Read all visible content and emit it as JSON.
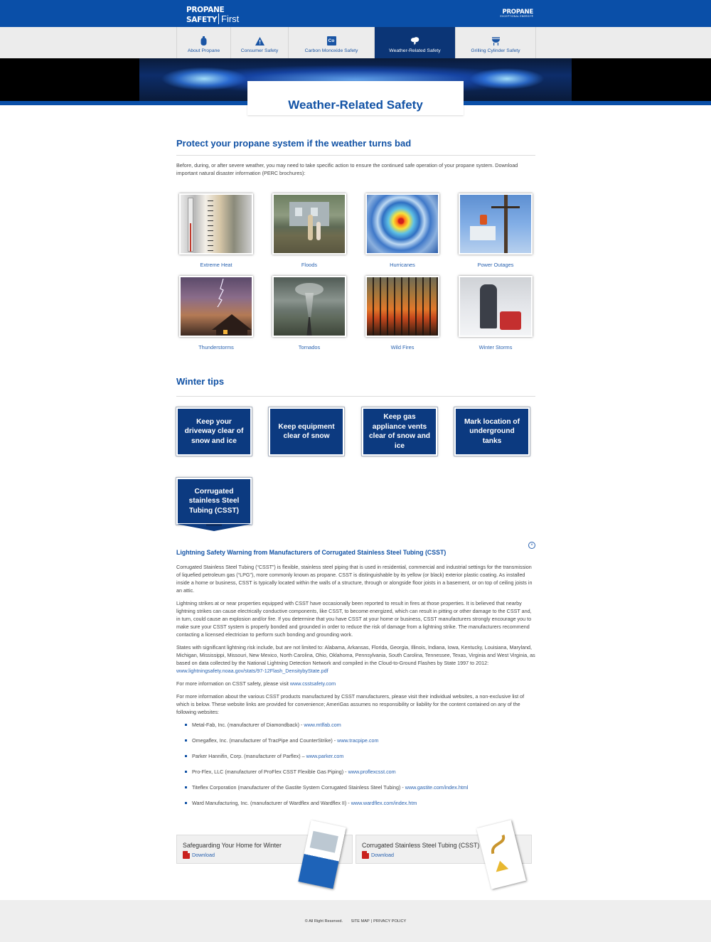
{
  "header": {
    "logo_line1": "PROPANE",
    "logo_line2": "SAFETY",
    "logo_line3": "First",
    "brand_right_line1": "PROPANE",
    "brand_right_line2": "EXCEPTIONAL ENERGY®",
    "colors": {
      "primary": "#0a4fa8",
      "nav_active": "#0b3576",
      "tile": "#0c3a80"
    }
  },
  "nav": [
    {
      "label": "About Propane",
      "icon": "propane-tank-icon"
    },
    {
      "label": "Consumer Safety",
      "icon": "warning-triangle-icon"
    },
    {
      "label": "Carbon Monoxide Safety",
      "icon": "co-badge-icon",
      "badge": "Co"
    },
    {
      "label": "Weather-Related Safety",
      "icon": "storm-cloud-icon",
      "active": true
    },
    {
      "label": "Grilling Cylinder Safety",
      "icon": "grill-icon"
    }
  ],
  "page_title": "Weather-Related Safety",
  "section1": {
    "heading": "Protect your propane system if the weather turns bad",
    "intro": "Before, during, or after severe weather, you may need to take specific action to ensure the continued safe operation of your propane system. Download important natural disaster information (PERC brochures):",
    "cards": [
      {
        "label": "Extreme Heat"
      },
      {
        "label": "Floods"
      },
      {
        "label": "Hurricanes"
      },
      {
        "label": "Power Outages"
      },
      {
        "label": "Thunderstorms"
      },
      {
        "label": "Tornados"
      },
      {
        "label": "Wild Fires"
      },
      {
        "label": "Winter Storms"
      }
    ]
  },
  "section2": {
    "heading": "Winter tips",
    "tips": [
      "Keep your driveway clear of snow and ice",
      "Keep equipment clear of snow",
      "Keep gas appliance vents clear of snow and ice",
      "Mark location of underground tanks",
      "Corrugated stainless Steel Tubing (CSST)"
    ]
  },
  "csst": {
    "close": "×",
    "heading": "Lightning Safety Warning from Manufacturers of Corrugated Stainless Steel Tubing (CSST)",
    "p1": "Corrugated Stainless Steel Tubing (“CSST”) is flexible, stainless steel piping that is used in residential, commercial and industrial settings for the transmission of liquefied petroleum gas (“LPG”), more commonly known as propane. CSST is distinguishable by its yellow (or black) exterior plastic coating. As installed inside a home or business, CSST is typically located within the walls of a structure, through or alongside floor joists in a basement, or on top of ceiling joists in an attic.",
    "p2": "Lightning strikes at or near properties equipped with CSST have occasionally been reported to result in fires at those properties. It is believed that nearby lightning strikes can cause electrically conductive components, like CSST, to become energized, which can result in pitting or other damage to the CSST and, in turn, could cause an explosion and/or fire. If you determine that you have CSST at your home or business, CSST manufacturers strongly encourage you to make sure your CSST system is properly bonded and grounded in order to reduce the risk of damage from a lightning strike. The manufacturers recommend contacting a licensed electrician to perform such bonding and grounding work.",
    "p3_text": "States with significant lightning risk include, but are not limited to: Alabama, Arkansas, Florida, Georgia, Illinois, Indiana, Iowa, Kentucky, Louisiana, Maryland, Michigan, Mississippi, Missouri, New Mexico, North Carolina, Ohio, Oklahoma, Pennsylvania, South Carolina, Tennessee, Texas, Virginia and West Virginia, as based on data collected by the National Lightning Detection Network and compiled in the Cloud-to-Ground Flashes by State 1997 to 2012:",
    "p3_link": "www.lightningsafety.noaa.gov/stats/97-12Flash_DensitybyState.pdf",
    "p4_text": "For more information on CSST safety, please visit",
    "p4_link": "www.csstsafety.com",
    "p5": "For more information about the various CSST products manufactured by CSST manufacturers, please visit their individual websites, a non-exclusive list of which is below. These website links are provided for convenience; AmeriGas assumes no responsibility or liability for the content contained on any of the following websites:",
    "manufacturers": [
      {
        "text": "Metal-Fab, Inc. (manufacturer of Diamondback) -",
        "link": "www.mtlfab.com"
      },
      {
        "text": "Omegaflex, Inc. (manufacturer of TracPipe and CounterStrike) -",
        "link": "www.tracpipe.com"
      },
      {
        "text": "Parker Hannifin, Corp. (manufacturer of Parflex) –",
        "link": "www.parker.com"
      },
      {
        "text": "Pro-Flex, LLC (manufacturer of ProFlex CSST Flexible Gas Piping) -",
        "link": "www.proflexcsst.com"
      },
      {
        "text": "Titeflex Corporation (manufacturer of the Gastite System Corrugated Stainless Steel Tubing) -",
        "link": "www.gastite.com/index.html"
      },
      {
        "text": "Ward Manufacturing, Inc. (manufacturer of Wardflex and Wardflex II) -",
        "link": "www.wardflex.com/index.htm"
      }
    ]
  },
  "downloads": [
    {
      "title": "Safeguarding Your Home for Winter",
      "link": "Download"
    },
    {
      "title": "Corrugated Stainless Steel Tubing (CSST)",
      "link": "Download"
    }
  ],
  "footer": {
    "copyright": "© All Right Reserved.",
    "sitemap": "SITE MAP",
    "sep": "|",
    "privacy": "PRIVACY POLICY"
  }
}
